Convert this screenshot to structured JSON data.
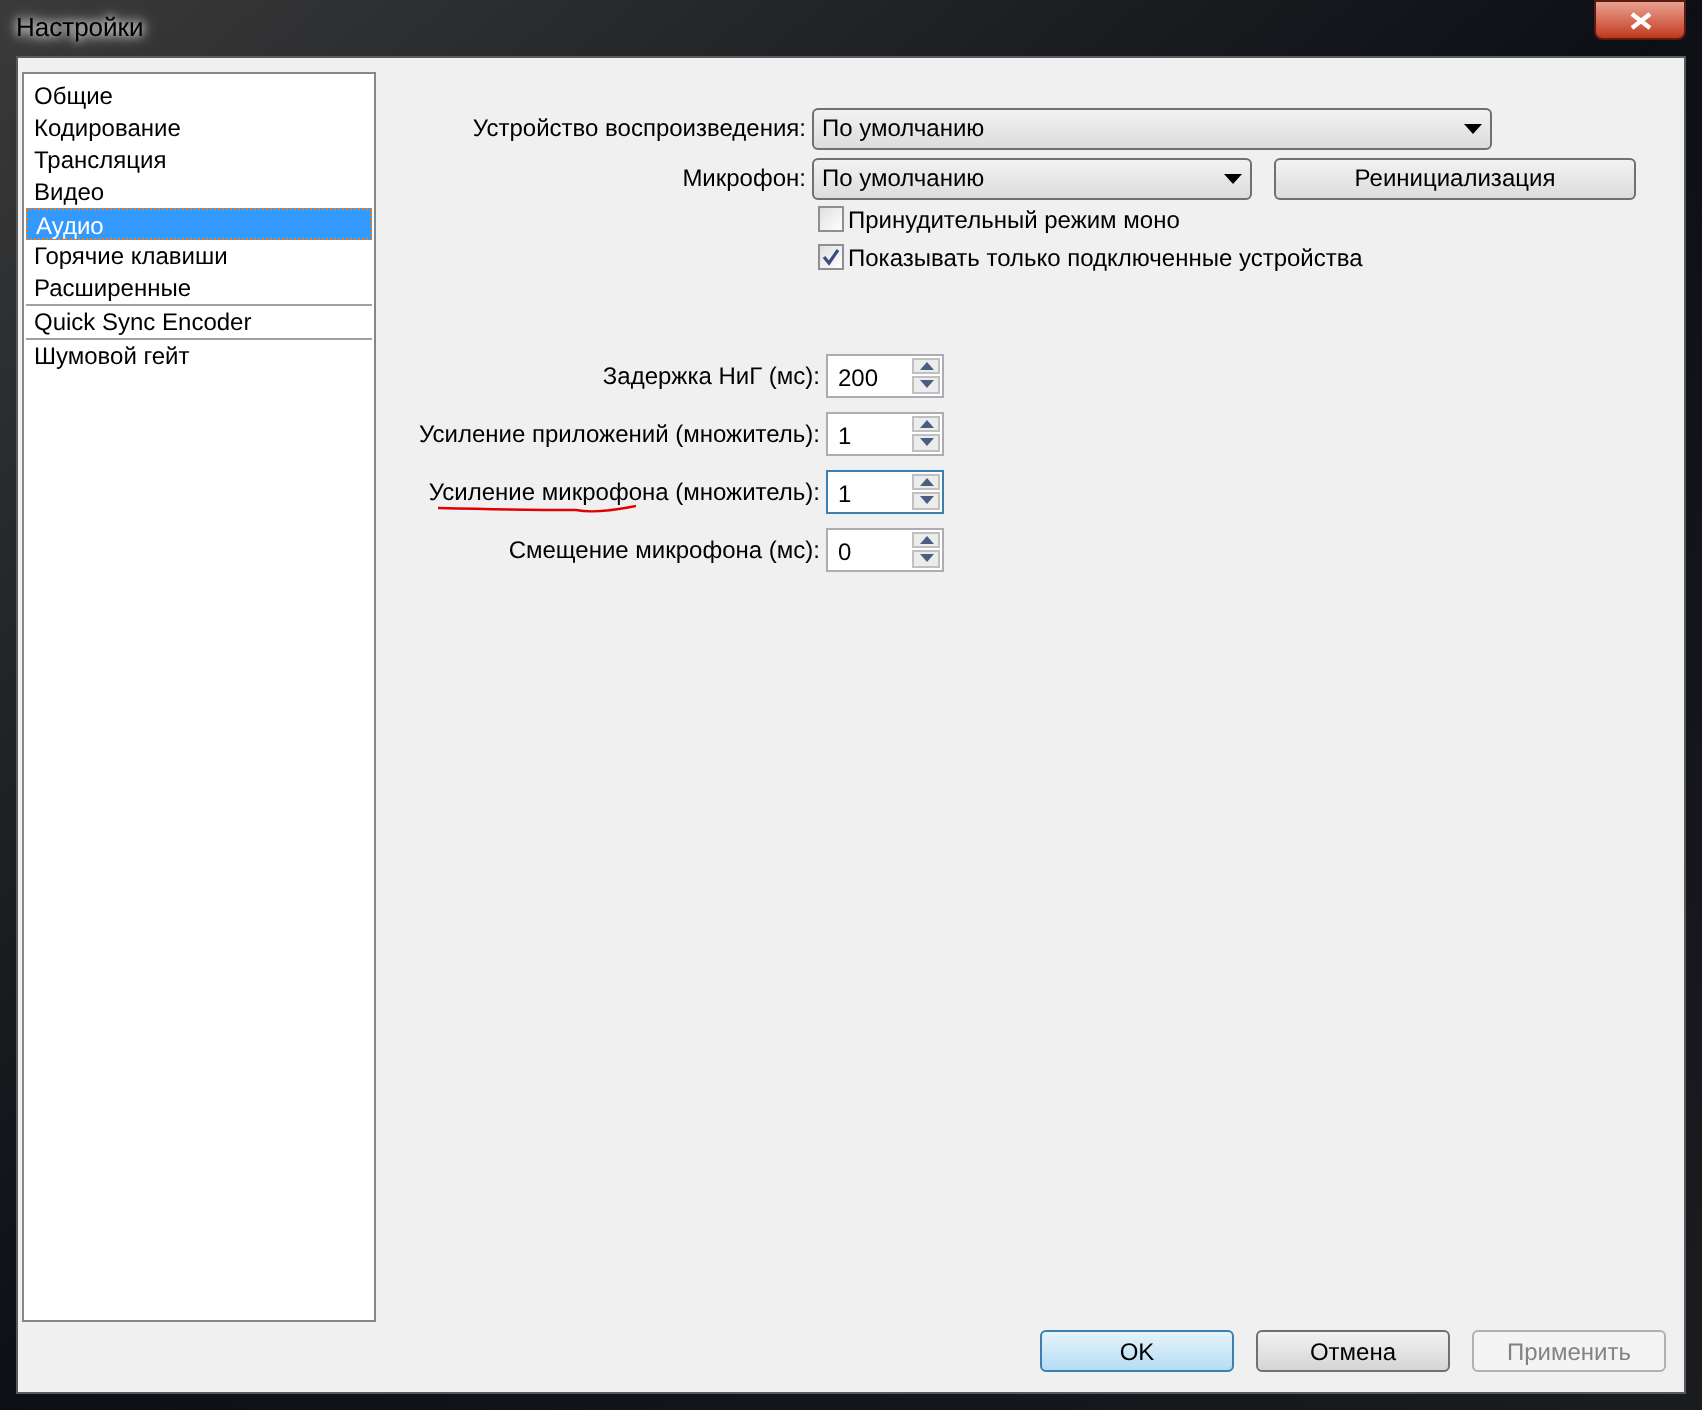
{
  "window": {
    "title": "Настройки"
  },
  "sidebar": {
    "items": [
      {
        "label": "Общие",
        "selected": false,
        "separator_before": false
      },
      {
        "label": "Кодирование",
        "selected": false,
        "separator_before": false
      },
      {
        "label": "Трансляция",
        "selected": false,
        "separator_before": false
      },
      {
        "label": "Видео",
        "selected": false,
        "separator_before": false
      },
      {
        "label": "Аудио",
        "selected": true,
        "separator_before": false
      },
      {
        "label": "Горячие клавиши",
        "selected": false,
        "separator_before": false
      },
      {
        "label": "Расширенные",
        "selected": false,
        "separator_before": false
      },
      {
        "label": "Quick Sync Encoder",
        "selected": false,
        "separator_before": true
      },
      {
        "label": "Шумовой гейт",
        "selected": false,
        "separator_before": true
      }
    ]
  },
  "devices": {
    "playback": {
      "label": "Устройство воспроизведения:",
      "value": "По умолчанию"
    },
    "microphone": {
      "label": "Микрофон:",
      "value": "По умолчанию"
    },
    "reinit_button": "Реинициализация",
    "checkboxes": [
      {
        "label": "Принудительный режим моно",
        "checked": false
      },
      {
        "label": "Показывать только подключенные устройства",
        "checked": true
      }
    ]
  },
  "spinners": [
    {
      "label": "Задержка НиГ (мс):",
      "value": "200",
      "focused": false,
      "underlined": false
    },
    {
      "label": "Усиление приложений (множитель):",
      "value": "1",
      "focused": false,
      "underlined": false
    },
    {
      "label": "Усиление микрофона (множитель):",
      "value": "1",
      "focused": true,
      "underlined": true
    },
    {
      "label": "Смещение микрофона (мс):",
      "value": "0",
      "focused": false,
      "underlined": false
    }
  ],
  "buttons": [
    {
      "label": "OK",
      "default": true,
      "disabled": false
    },
    {
      "label": "Отмена",
      "default": false,
      "disabled": false
    },
    {
      "label": "Применить",
      "default": false,
      "disabled": true
    }
  ]
}
